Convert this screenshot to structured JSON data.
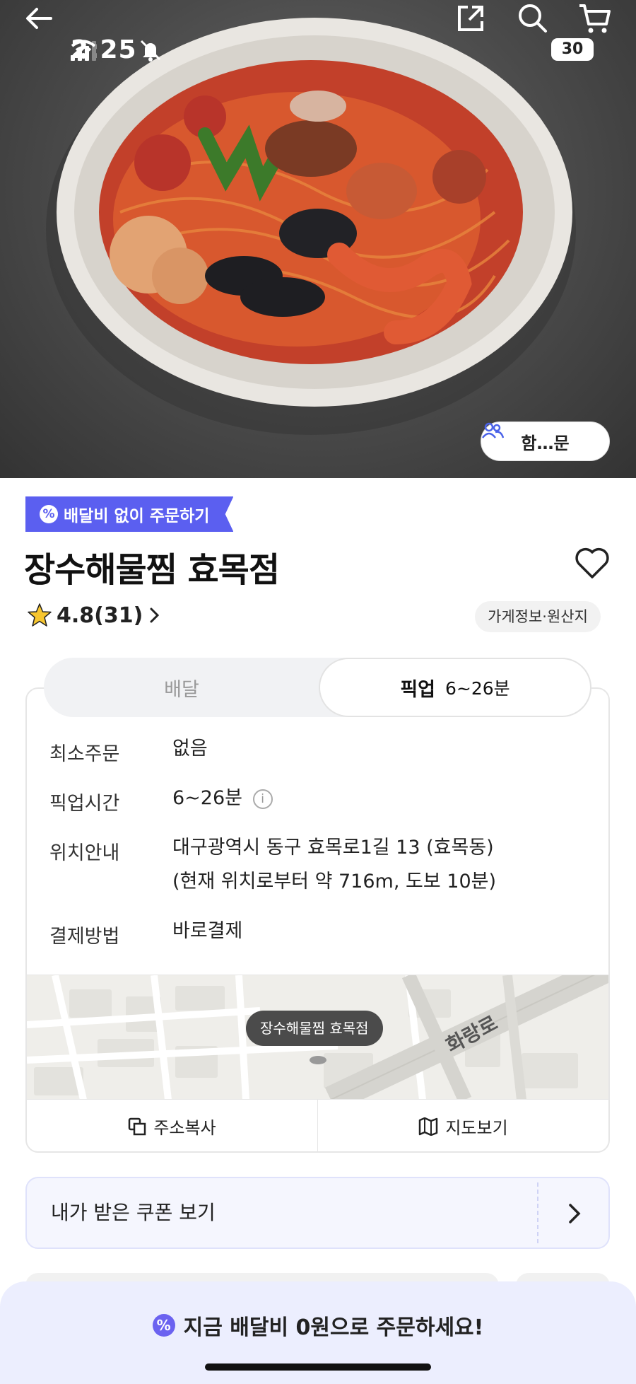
{
  "status": {
    "time": "2:25",
    "battery": "30"
  },
  "hero": {
    "together_label": "함…문"
  },
  "store": {
    "promo_label": "배달비 없이 주문하기",
    "name": "장수해물찜 효목점",
    "rating": "4.8",
    "review_count": "(31)",
    "info_link": "가게정보·원산지"
  },
  "tabs": {
    "delivery": "배달",
    "pickup": "픽업",
    "pickup_time": "6~26분"
  },
  "details": {
    "min_order_label": "최소주문",
    "min_order_value": "없음",
    "pickup_time_label": "픽업시간",
    "pickup_time_value": "6~26분",
    "location_label": "위치안내",
    "location_line1": "대구광역시 동구 효목로1길 13 (효목동)",
    "location_line2": "(현재 위치로부터 약 716m, 도보 10분)",
    "payment_label": "결제방법",
    "payment_value": "바로결제"
  },
  "map": {
    "pin_label": "장수해물찜 효목점",
    "road_label": "화랑로"
  },
  "map_actions": {
    "copy_address": "주소복사",
    "view_map": "지도보기"
  },
  "coupon": {
    "label": "내가 받은 쿠폰 보기"
  },
  "bottom_bar": {
    "text": "지금 배달비 0원으로 주문하세요!"
  },
  "colors": {
    "accent": "#5b5ff0",
    "bottom_bg": "#eceefe"
  },
  "icons": [
    "bell-off-icon",
    "signal-icon",
    "wifi-icon",
    "back-arrow-icon",
    "share-icon",
    "search-icon",
    "cart-icon",
    "group-icon",
    "discount-icon",
    "heart-icon",
    "star-icon",
    "chevron-right-icon",
    "info-icon",
    "copy-icon",
    "map-icon"
  ]
}
